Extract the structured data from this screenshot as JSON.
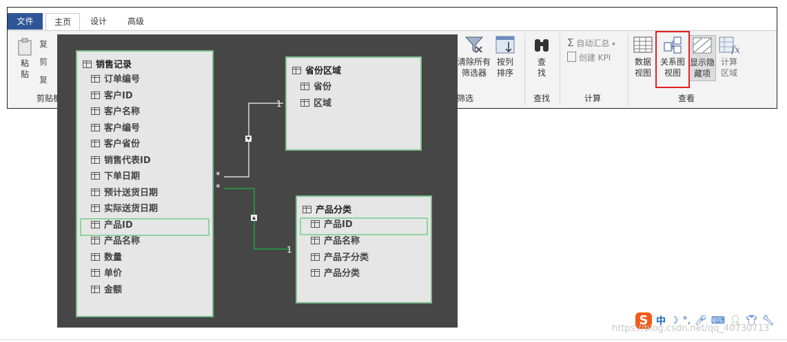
{
  "ribbon": {
    "tabs": [
      "文件",
      "主页",
      "设计",
      "高级"
    ],
    "clipboard": {
      "paste_label_1": "粘",
      "paste_label_2": "贴",
      "group_label": "剪贴板",
      "small_1": "复",
      "small_2": "剪",
      "small_3": "复"
    },
    "filter": {
      "clear_all_1": "清除所有",
      "clear_all_2": "筛选器",
      "sort_1": "按列",
      "sort_2": "排序",
      "group_label": "筛选"
    },
    "find": {
      "label_1": "查",
      "label_2": "找",
      "group_label": "查找"
    },
    "calc": {
      "autosum": "自动汇总",
      "create_kpi": "创建 KPI",
      "group_label": "计算"
    },
    "view": {
      "data_view_1": "数据",
      "data_view_2": "视图",
      "diagram_view_1": "关系图",
      "diagram_view_2": "视图",
      "show_hidden_1": "显示隐",
      "show_hidden_2": "藏项",
      "calc_area_1": "计算",
      "calc_area_2": "区域",
      "group_label": "查看"
    }
  },
  "diagram": {
    "tables": [
      {
        "title": "销售记录",
        "fields": [
          "订单编号",
          "客户ID",
          "客户名称",
          "客户编号",
          "客户省份",
          "销售代表ID",
          "下单日期",
          "预计送货日期",
          "实际送货日期",
          "产品ID",
          "产品名称",
          "数量",
          "单价",
          "金额"
        ],
        "selected": "产品ID"
      },
      {
        "title": "省份区域",
        "fields": [
          "省份",
          "区域"
        ]
      },
      {
        "title": "产品分类",
        "fields": [
          "产品ID",
          "产品名称",
          "产品子分类",
          "产品分类"
        ],
        "selected": "产品ID"
      }
    ],
    "relationships": [
      {
        "from": "销售记录",
        "to": "省份区域",
        "from_card": "*",
        "to_card": "1",
        "color": "#d8d8d8"
      },
      {
        "from": "销售记录",
        "to": "产品分类",
        "from_card": "*",
        "to_card": "1",
        "color": "#2e8b44"
      }
    ]
  },
  "ime": {
    "brand": "S",
    "mode": "中",
    "punct": "°,"
  },
  "watermark": "https://blog.csdn.net/qq_40730713"
}
